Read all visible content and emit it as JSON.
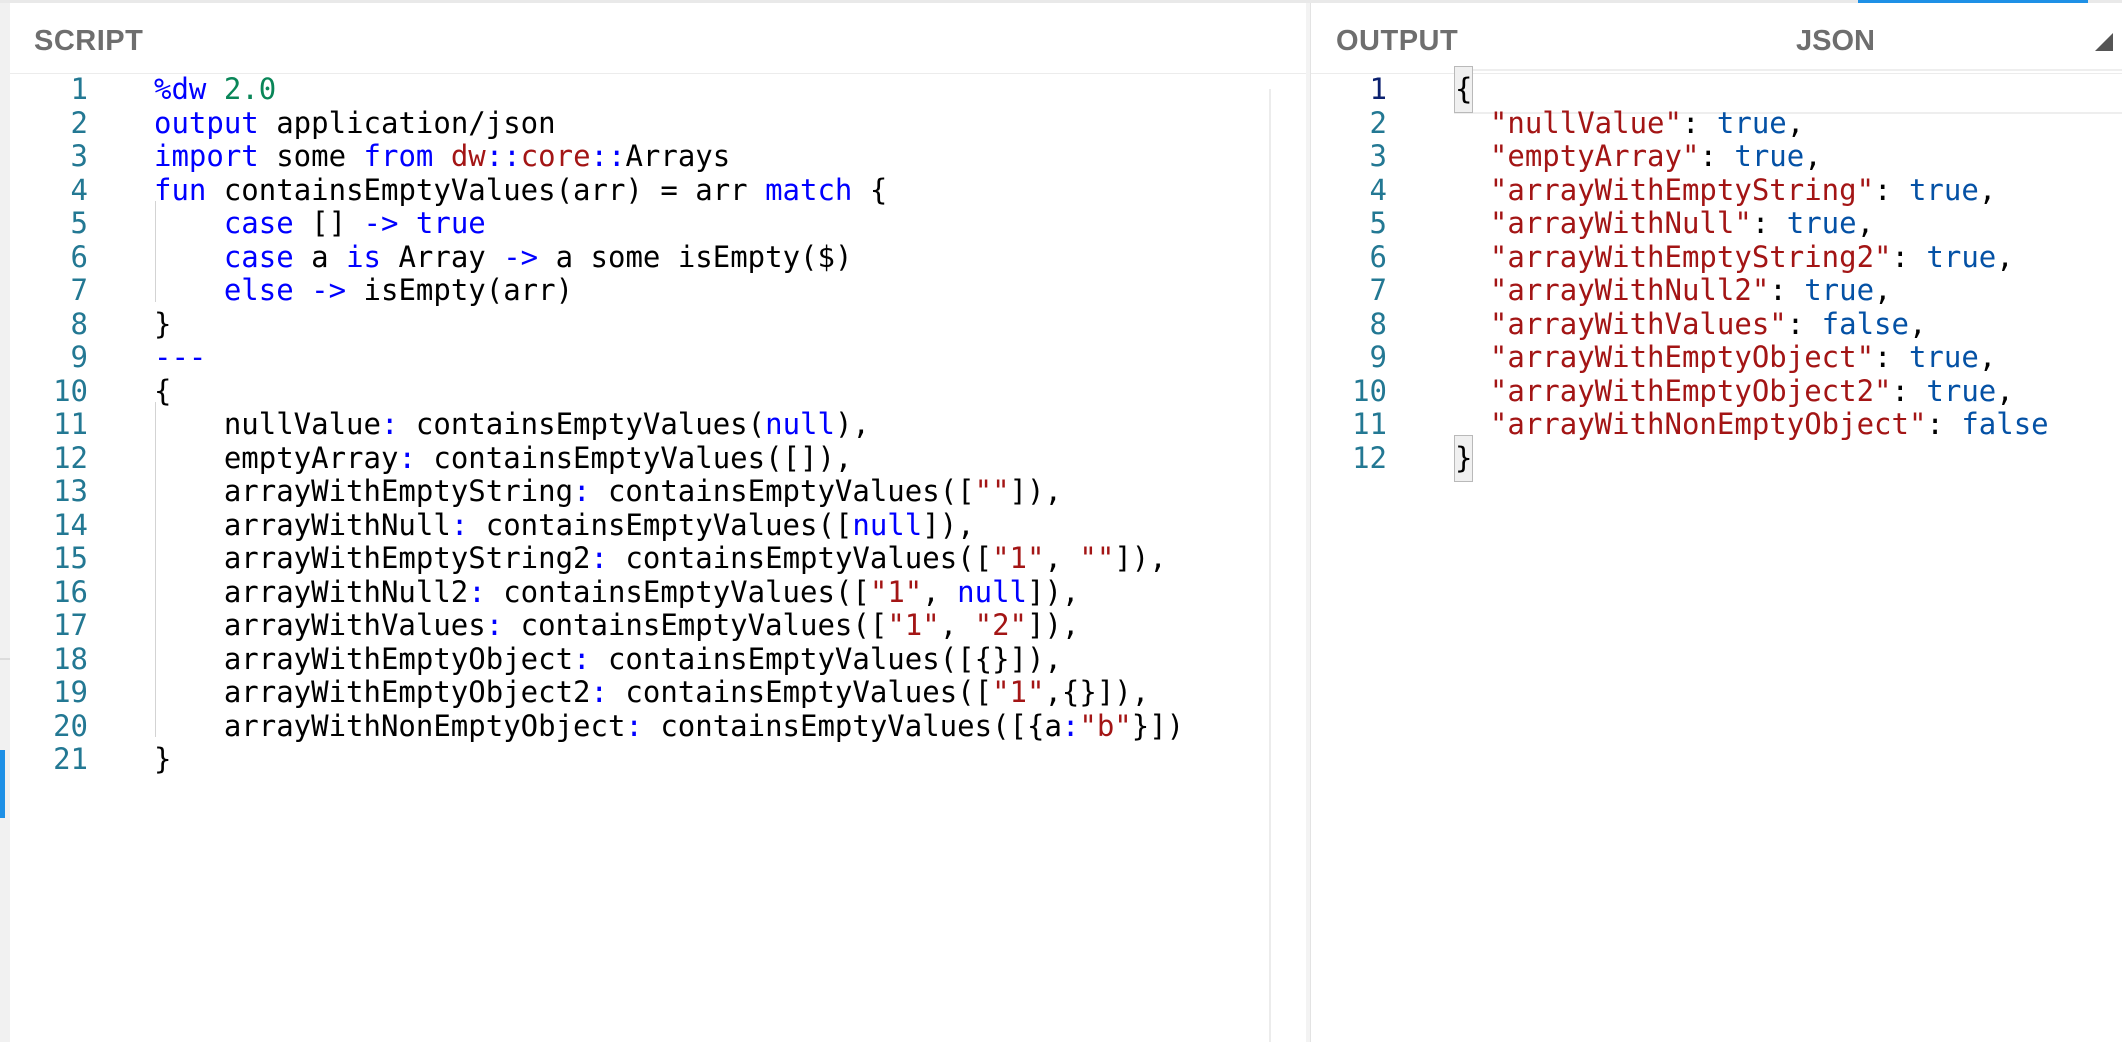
{
  "script_pane": {
    "title": "SCRIPT",
    "lines": [
      {
        "n": "1",
        "tokens": [
          [
            "k",
            "%dw"
          ],
          [
            "p",
            " "
          ],
          [
            "n",
            "2.0"
          ]
        ]
      },
      {
        "n": "2",
        "tokens": [
          [
            "k",
            "output"
          ],
          [
            "p",
            " application/json"
          ]
        ]
      },
      {
        "n": "3",
        "tokens": [
          [
            "k",
            "import"
          ],
          [
            "p",
            " some "
          ],
          [
            "k",
            "from"
          ],
          [
            "p",
            " "
          ],
          [
            "ns",
            "dw"
          ],
          [
            "k",
            "::"
          ],
          [
            "ns",
            "core"
          ],
          [
            "k",
            "::"
          ],
          [
            "p",
            "Arrays"
          ]
        ]
      },
      {
        "n": "4",
        "tokens": [
          [
            "k",
            "fun"
          ],
          [
            "p",
            " containsEmptyValues(arr) = arr "
          ],
          [
            "k",
            "match"
          ],
          [
            "p",
            " {"
          ]
        ]
      },
      {
        "n": "5",
        "tokens": [
          [
            "p",
            "    "
          ],
          [
            "k",
            "case"
          ],
          [
            "p",
            " [] "
          ],
          [
            "k",
            "->"
          ],
          [
            "p",
            " "
          ],
          [
            "k",
            "true"
          ]
        ]
      },
      {
        "n": "6",
        "tokens": [
          [
            "p",
            "    "
          ],
          [
            "k",
            "case"
          ],
          [
            "p",
            " a "
          ],
          [
            "k",
            "is"
          ],
          [
            "p",
            " Array "
          ],
          [
            "k",
            "->"
          ],
          [
            "p",
            " a some isEmpty($)"
          ]
        ]
      },
      {
        "n": "7",
        "tokens": [
          [
            "p",
            "    "
          ],
          [
            "k",
            "else"
          ],
          [
            "p",
            " "
          ],
          [
            "k",
            "->"
          ],
          [
            "p",
            " isEmpty(arr)"
          ]
        ]
      },
      {
        "n": "8",
        "tokens": [
          [
            "p",
            "}"
          ]
        ]
      },
      {
        "n": "9",
        "tokens": [
          [
            "k",
            "---"
          ]
        ]
      },
      {
        "n": "10",
        "tokens": [
          [
            "p",
            "{"
          ]
        ]
      },
      {
        "n": "11",
        "tokens": [
          [
            "p",
            "    nullValue"
          ],
          [
            "k",
            ":"
          ],
          [
            "p",
            " containsEmptyValues("
          ],
          [
            "k",
            "null"
          ],
          [
            "p",
            "),"
          ]
        ]
      },
      {
        "n": "12",
        "tokens": [
          [
            "p",
            "    emptyArray"
          ],
          [
            "k",
            ":"
          ],
          [
            "p",
            " containsEmptyValues([]),"
          ]
        ]
      },
      {
        "n": "13",
        "tokens": [
          [
            "p",
            "    arrayWithEmptyString"
          ],
          [
            "k",
            ":"
          ],
          [
            "p",
            " containsEmptyValues(["
          ],
          [
            "s",
            "\"\""
          ],
          [
            "p",
            "]),"
          ]
        ]
      },
      {
        "n": "14",
        "tokens": [
          [
            "p",
            "    arrayWithNull"
          ],
          [
            "k",
            ":"
          ],
          [
            "p",
            " containsEmptyValues(["
          ],
          [
            "k",
            "null"
          ],
          [
            "p",
            "]),"
          ]
        ]
      },
      {
        "n": "15",
        "tokens": [
          [
            "p",
            "    arrayWithEmptyString2"
          ],
          [
            "k",
            ":"
          ],
          [
            "p",
            " containsEmptyValues(["
          ],
          [
            "s",
            "\"1\""
          ],
          [
            "p",
            ", "
          ],
          [
            "s",
            "\"\""
          ],
          [
            "p",
            "]),"
          ]
        ]
      },
      {
        "n": "16",
        "tokens": [
          [
            "p",
            "    arrayWithNull2"
          ],
          [
            "k",
            ":"
          ],
          [
            "p",
            " containsEmptyValues(["
          ],
          [
            "s",
            "\"1\""
          ],
          [
            "p",
            ", "
          ],
          [
            "k",
            "null"
          ],
          [
            "p",
            "]),"
          ]
        ]
      },
      {
        "n": "17",
        "tokens": [
          [
            "p",
            "    arrayWithValues"
          ],
          [
            "k",
            ":"
          ],
          [
            "p",
            " containsEmptyValues(["
          ],
          [
            "s",
            "\"1\""
          ],
          [
            "p",
            ", "
          ],
          [
            "s",
            "\"2\""
          ],
          [
            "p",
            "]),"
          ]
        ]
      },
      {
        "n": "18",
        "tokens": [
          [
            "p",
            "    arrayWithEmptyObject"
          ],
          [
            "k",
            ":"
          ],
          [
            "p",
            " containsEmptyValues([{}]),"
          ]
        ]
      },
      {
        "n": "19",
        "tokens": [
          [
            "p",
            "    arrayWithEmptyObject2"
          ],
          [
            "k",
            ":"
          ],
          [
            "p",
            " containsEmptyValues(["
          ],
          [
            "s",
            "\"1\""
          ],
          [
            "p",
            ",{}]),"
          ]
        ]
      },
      {
        "n": "20",
        "tokens": [
          [
            "p",
            "    arrayWithNonEmptyObject"
          ],
          [
            "k",
            ":"
          ],
          [
            "p",
            " containsEmptyValues([{a"
          ],
          [
            "k",
            ":"
          ],
          [
            "s",
            "\"b\""
          ],
          [
            "p",
            "}])"
          ]
        ]
      },
      {
        "n": "21",
        "tokens": [
          [
            "p",
            "}"
          ]
        ]
      }
    ]
  },
  "output_pane": {
    "title": "OUTPUT",
    "format": "JSON",
    "dropdown_icon": "triangle-corner-icon",
    "lines": [
      {
        "n": "1",
        "tokens": [
          [
            "box",
            "{"
          ]
        ]
      },
      {
        "n": "2",
        "tokens": [
          [
            "p",
            "  "
          ],
          [
            "s",
            "\"nullValue\""
          ],
          [
            "p",
            ": "
          ],
          [
            "b",
            "true"
          ],
          [
            "p",
            ","
          ]
        ]
      },
      {
        "n": "3",
        "tokens": [
          [
            "p",
            "  "
          ],
          [
            "s",
            "\"emptyArray\""
          ],
          [
            "p",
            ": "
          ],
          [
            "b",
            "true"
          ],
          [
            "p",
            ","
          ]
        ]
      },
      {
        "n": "4",
        "tokens": [
          [
            "p",
            "  "
          ],
          [
            "s",
            "\"arrayWithEmptyString\""
          ],
          [
            "p",
            ": "
          ],
          [
            "b",
            "true"
          ],
          [
            "p",
            ","
          ]
        ]
      },
      {
        "n": "5",
        "tokens": [
          [
            "p",
            "  "
          ],
          [
            "s",
            "\"arrayWithNull\""
          ],
          [
            "p",
            ": "
          ],
          [
            "b",
            "true"
          ],
          [
            "p",
            ","
          ]
        ]
      },
      {
        "n": "6",
        "tokens": [
          [
            "p",
            "  "
          ],
          [
            "s",
            "\"arrayWithEmptyString2\""
          ],
          [
            "p",
            ": "
          ],
          [
            "b",
            "true"
          ],
          [
            "p",
            ","
          ]
        ]
      },
      {
        "n": "7",
        "tokens": [
          [
            "p",
            "  "
          ],
          [
            "s",
            "\"arrayWithNull2\""
          ],
          [
            "p",
            ": "
          ],
          [
            "b",
            "true"
          ],
          [
            "p",
            ","
          ]
        ]
      },
      {
        "n": "8",
        "tokens": [
          [
            "p",
            "  "
          ],
          [
            "s",
            "\"arrayWithValues\""
          ],
          [
            "p",
            ": "
          ],
          [
            "b",
            "false"
          ],
          [
            "p",
            ","
          ]
        ]
      },
      {
        "n": "9",
        "tokens": [
          [
            "p",
            "  "
          ],
          [
            "s",
            "\"arrayWithEmptyObject\""
          ],
          [
            "p",
            ": "
          ],
          [
            "b",
            "true"
          ],
          [
            "p",
            ","
          ]
        ]
      },
      {
        "n": "10",
        "tokens": [
          [
            "p",
            "  "
          ],
          [
            "s",
            "\"arrayWithEmptyObject2\""
          ],
          [
            "p",
            ": "
          ],
          [
            "b",
            "true"
          ],
          [
            "p",
            ","
          ]
        ]
      },
      {
        "n": "11",
        "tokens": [
          [
            "p",
            "  "
          ],
          [
            "s",
            "\"arrayWithNonEmptyObject\""
          ],
          [
            "p",
            ": "
          ],
          [
            "b",
            "false"
          ]
        ]
      },
      {
        "n": "12",
        "tokens": [
          [
            "box",
            "}"
          ]
        ]
      }
    ]
  },
  "colors": {
    "keyword": "#0000ff",
    "string": "#a31515",
    "number": "#098658",
    "boolean": "#0451a5",
    "line_number": "#237893",
    "accent": "#1e90e6"
  }
}
